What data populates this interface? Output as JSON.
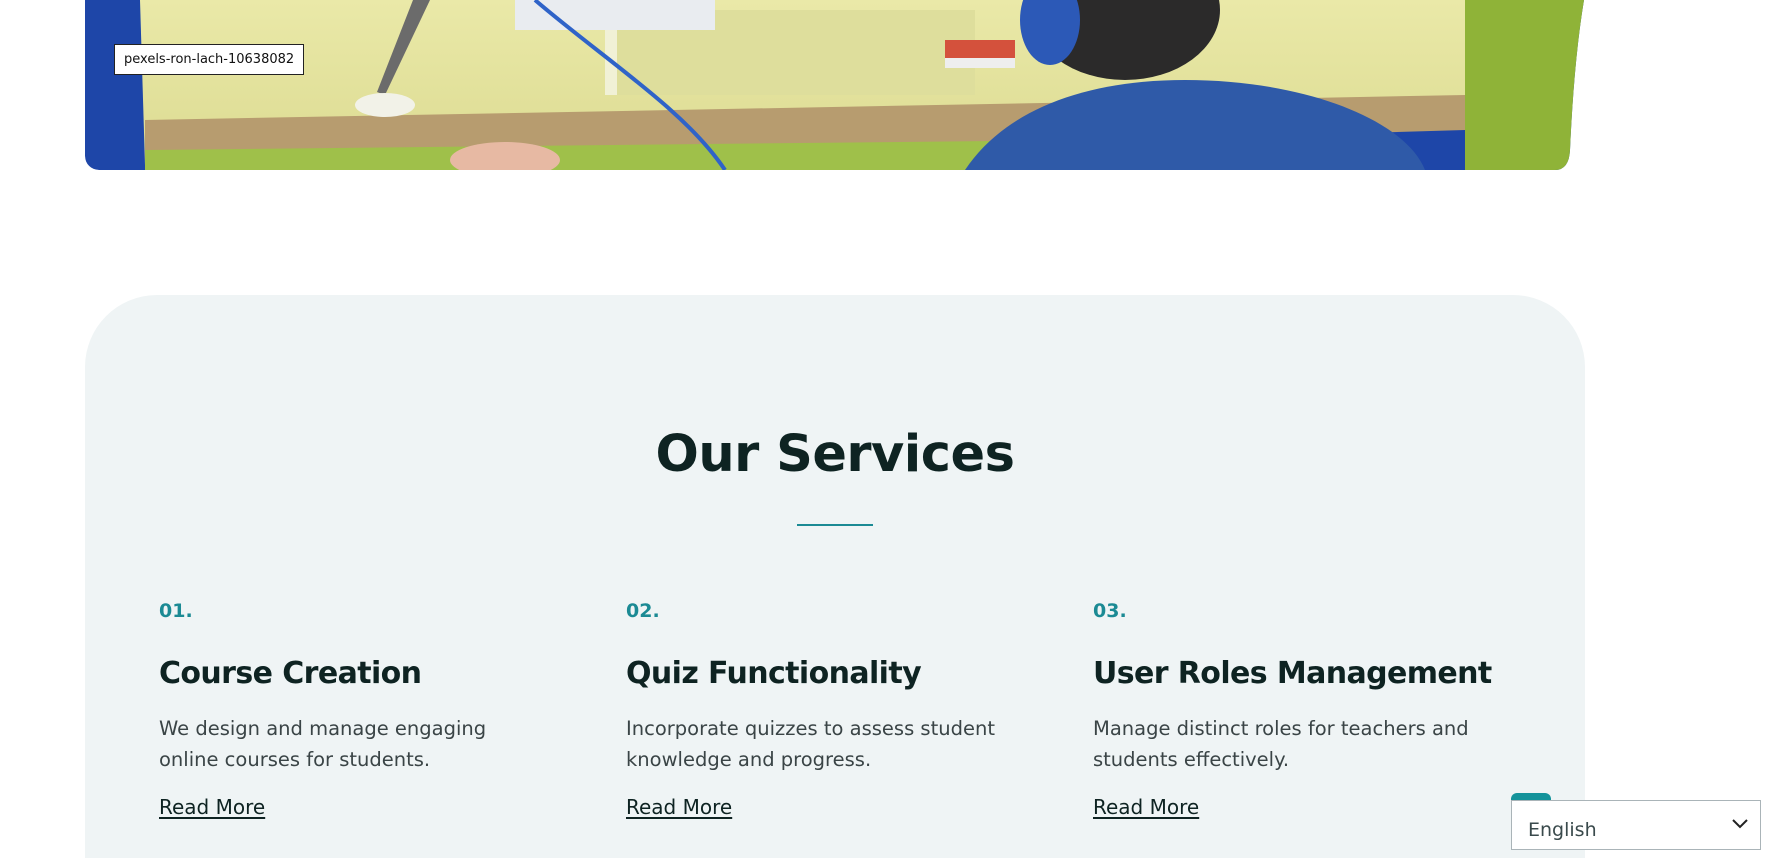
{
  "hero": {
    "image_caption": "pexels-ron-lach-10638082"
  },
  "services": {
    "title": "Our Services",
    "items": [
      {
        "number": "01.",
        "title": "Course Creation",
        "description": "We design and manage engaging online courses for students.",
        "link": "Read More"
      },
      {
        "number": "02.",
        "title": "Quiz Functionality",
        "description": "Incorporate quizzes to assess student knowledge and progress.",
        "link": "Read More"
      },
      {
        "number": "03.",
        "title": "User Roles Management",
        "description": "Manage distinct roles for teachers and students effectively.",
        "link": "Read More"
      }
    ]
  },
  "language": {
    "selected": "English"
  },
  "colors": {
    "accent": "#1b8a94",
    "panel_bg": "#eff4f5",
    "heading": "#0e2322"
  }
}
